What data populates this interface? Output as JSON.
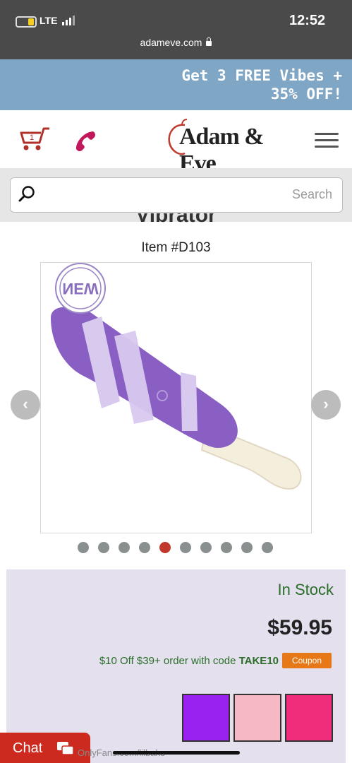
{
  "status_bar": {
    "time": "12:52",
    "network": "LTE"
  },
  "browser": {
    "url": "adameve.com"
  },
  "promo": {
    "line1": "Get 3 FREE Vibes +",
    "line2": "35% OFF!"
  },
  "header": {
    "logo_text": "Adam & Eve"
  },
  "search": {
    "placeholder": "Search"
  },
  "product": {
    "title_partial": "Vibrator",
    "item_number": "Item #D103",
    "badge": "NEW",
    "image_count": 10,
    "active_image_index": 4
  },
  "purchase": {
    "stock_status": "In Stock",
    "price": "$59.95",
    "coupon_label": "Coupon",
    "coupon_text": "$10 Off $39+ order with code",
    "coupon_code": "TAKE10"
  },
  "colors": {
    "swatches": [
      "#f02d7a",
      "#f5b8c4",
      "#9a22f0"
    ],
    "accent": "#cc2a1f",
    "promo_bg": "#7fa6c5",
    "product_purple": "#8a5fc4"
  },
  "chat": {
    "label": "Chat"
  },
  "watermark": "OnlyFans.com/lilbake"
}
